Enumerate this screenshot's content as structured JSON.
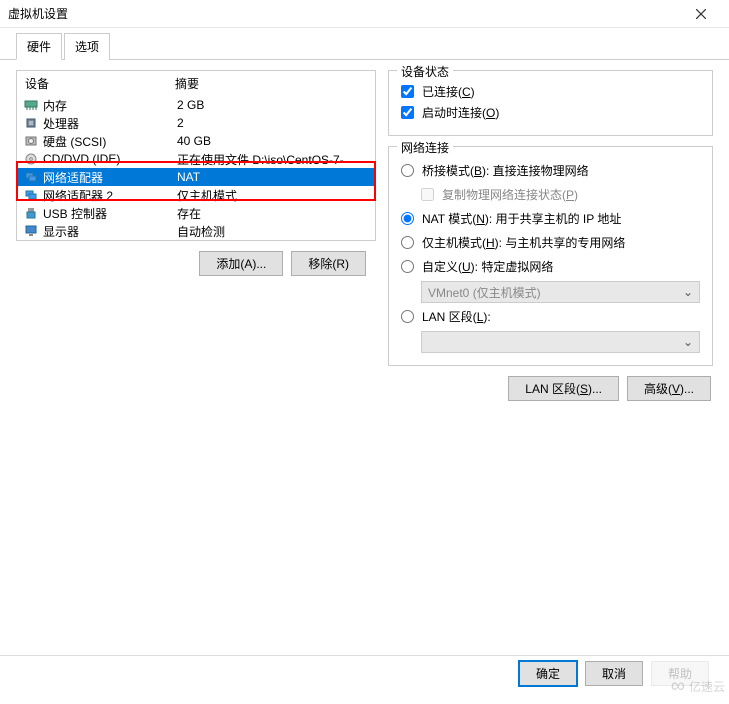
{
  "window": {
    "title": "虚拟机设置"
  },
  "tabs": {
    "hardware": "硬件",
    "options": "选项",
    "active": "hardware"
  },
  "deviceList": {
    "headers": {
      "device": "设备",
      "summary": "摘要"
    },
    "items": [
      {
        "name": "内存",
        "summary": "2 GB",
        "icon": "memory",
        "selected": false
      },
      {
        "name": "处理器",
        "summary": "2",
        "icon": "cpu",
        "selected": false
      },
      {
        "name": "硬盘 (SCSI)",
        "summary": "40 GB",
        "icon": "disk",
        "selected": false
      },
      {
        "name": "CD/DVD (IDE)",
        "summary": "正在使用文件 D:\\iso\\CentOS-7-",
        "icon": "cd",
        "selected": false
      },
      {
        "name": "网络适配器",
        "summary": "NAT",
        "icon": "net",
        "selected": true
      },
      {
        "name": "网络适配器 2",
        "summary": "仅主机模式",
        "icon": "net",
        "selected": false
      },
      {
        "name": "USB 控制器",
        "summary": "存在",
        "icon": "usb",
        "selected": false
      },
      {
        "name": "显示器",
        "summary": "自动检测",
        "icon": "display",
        "selected": false
      }
    ],
    "highlightRows": [
      4,
      5
    ]
  },
  "leftButtons": {
    "add": "添加(A)...",
    "remove": "移除(R)"
  },
  "deviceStatus": {
    "title": "设备状态",
    "connected": "已连接(C)",
    "connectAtPowerOn": "启动时连接(O)",
    "connectedChecked": true,
    "connectAtPowerOnChecked": true
  },
  "networkConnection": {
    "title": "网络连接",
    "bridged": "桥接模式(B): 直接连接物理网络",
    "replicate": "复制物理网络连接状态(P)",
    "nat": "NAT 模式(N): 用于共享主机的 IP 地址",
    "hostOnly": "仅主机模式(H): 与主机共享的专用网络",
    "custom": "自定义(U): 特定虚拟网络",
    "customDropdown": "VMnet0 (仅主机模式)",
    "lanSegment": "LAN 区段(L):",
    "lanDropdown": "",
    "selected": "nat"
  },
  "rightButtons": {
    "lanSegments": "LAN 区段(S)...",
    "advanced": "高级(V)..."
  },
  "footer": {
    "ok": "确定",
    "cancel": "取消",
    "help": "帮助"
  },
  "watermark": "亿速云"
}
